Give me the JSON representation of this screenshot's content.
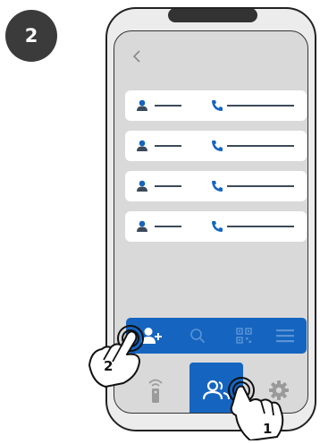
{
  "step": {
    "number": "2"
  },
  "screen": {
    "back_icon": "chevron-left-icon",
    "contacts": [
      {
        "icon": "user-icon",
        "phone_icon": "phone-icon"
      },
      {
        "icon": "user-icon",
        "phone_icon": "phone-icon"
      },
      {
        "icon": "user-icon",
        "phone_icon": "phone-icon"
      },
      {
        "icon": "user-icon",
        "phone_icon": "phone-icon"
      }
    ],
    "toolbar": {
      "items": [
        "add-user-icon",
        "search-icon",
        "qr-code-icon",
        "menu-icon"
      ]
    },
    "bottom_nav": {
      "items": [
        "remote-icon",
        "contacts-icon",
        "settings-icon"
      ],
      "active": "contacts-icon"
    }
  },
  "gestures": [
    {
      "label": "1",
      "target": "contacts-nav-button"
    },
    {
      "label": "2",
      "target": "add-user-button"
    }
  ],
  "colors": {
    "accent": "#1565c0",
    "phone_bg": "#d9d9d9",
    "row_bg": "#ffffff",
    "badge_bg": "#3b3b3b"
  }
}
